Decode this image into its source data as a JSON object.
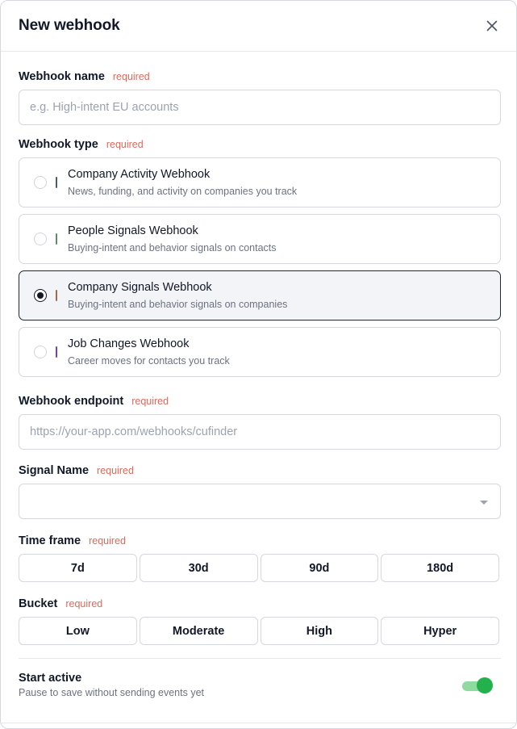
{
  "dialog": {
    "title": "New webhook",
    "close_icon": "close-icon"
  },
  "form": {
    "required_text": "required",
    "name": {
      "label": "Webhook name",
      "placeholder": "e.g. High-intent EU accounts",
      "value": ""
    },
    "type": {
      "label": "Webhook type",
      "options": [
        {
          "title": "Company Activity Webhook",
          "desc": "News, funding, and activity on companies you track",
          "color": "#4b5b68",
          "selected": false
        },
        {
          "title": "People Signals Webhook",
          "desc": "Buying-intent and behavior signals on contacts",
          "color": "#5f8a6b",
          "selected": false
        },
        {
          "title": "Company Signals Webhook",
          "desc": "Buying-intent and behavior signals on companies",
          "color": "#9b6a4f",
          "selected": true
        },
        {
          "title": "Job Changes Webhook",
          "desc": "Career moves for contacts you track",
          "color": "#6d3fd3",
          "selected": false
        }
      ]
    },
    "endpoint": {
      "label": "Webhook endpoint",
      "placeholder": "https://your-app.com/webhooks/cufinder",
      "value": ""
    },
    "signal_name": {
      "label": "Signal Name",
      "value": ""
    },
    "time_frame": {
      "label": "Time frame",
      "options": [
        "7d",
        "30d",
        "90d",
        "180d"
      ]
    },
    "bucket": {
      "label": "Bucket",
      "options": [
        "Low",
        "Moderate",
        "High",
        "Hyper"
      ]
    },
    "start_active": {
      "label": "Start active",
      "desc": "Pause to save without sending events yet",
      "on": true
    }
  },
  "colors": {
    "required": "#e0685a",
    "toggle_on": "#22b14c",
    "selected_border": "#1f2937"
  }
}
